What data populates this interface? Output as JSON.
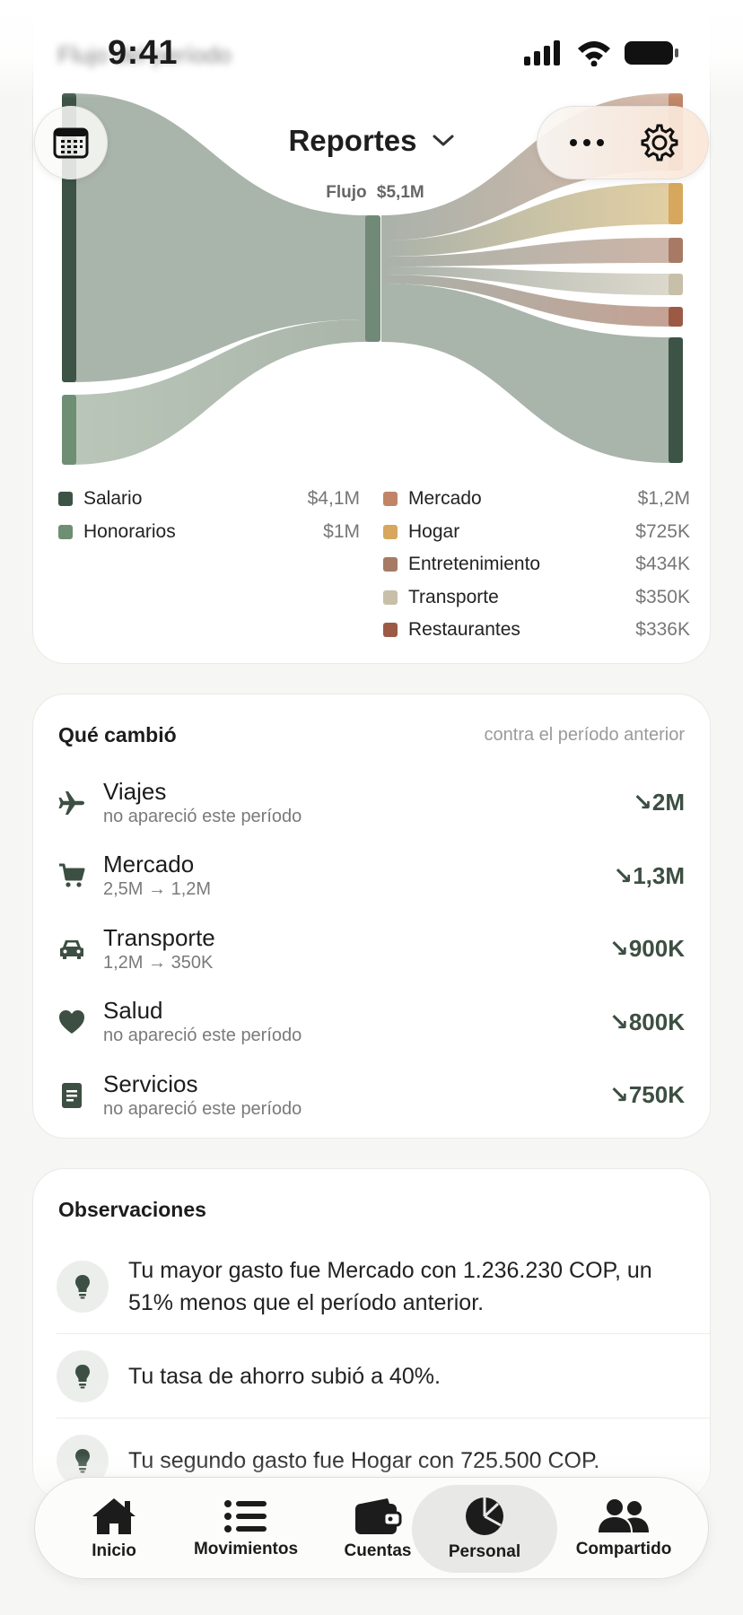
{
  "status": {
    "time": "9:41",
    "blurred_title": "Flujo del período"
  },
  "header": {
    "title": "Reportes"
  },
  "sankey": {
    "center_label": "Flujo",
    "center_value": "$5,1M",
    "income": [
      {
        "name": "Salario",
        "value": "$4,1M",
        "color": "#3d5346"
      },
      {
        "name": "Honorarios",
        "value": "$1M",
        "color": "#6e8f73"
      }
    ],
    "expenses": [
      {
        "name": "Mercado",
        "value": "$1,2M",
        "color": "#c08566"
      },
      {
        "name": "Hogar",
        "value": "$725K",
        "color": "#d6a75d"
      },
      {
        "name": "Entretenimiento",
        "value": "$434K",
        "color": "#a67a64"
      },
      {
        "name": "Transporte",
        "value": "$350K",
        "color": "#c8bfa8"
      },
      {
        "name": "Restaurantes",
        "value": "$336K",
        "color": "#9c5a44"
      }
    ]
  },
  "changes": {
    "title": "Qué cambió",
    "subtitle": "contra el período anterior",
    "items": [
      {
        "name": "Viajes",
        "detail": "no apareció este período",
        "value": "↘2M",
        "icon": "plane-icon"
      },
      {
        "name": "Mercado",
        "detail": "2,5M → 1,2M",
        "value": "↘1,3M",
        "icon": "cart-icon"
      },
      {
        "name": "Transporte",
        "detail": "1,2M → 350K",
        "value": "↘900K",
        "icon": "car-icon"
      },
      {
        "name": "Salud",
        "detail": "no apareció este período",
        "value": "↘800K",
        "icon": "heart-icon"
      },
      {
        "name": "Servicios",
        "detail": "no apareció este período",
        "value": "↘750K",
        "icon": "receipt-icon"
      }
    ]
  },
  "observations": {
    "title": "Observaciones",
    "items": [
      {
        "text": "Tu mayor gasto fue Mercado con 1.236.230 COP, un 51% menos que el período anterior."
      },
      {
        "text": "Tu tasa de ahorro subió a 40%."
      },
      {
        "text": "Tu segundo gasto fue Hogar con 725.500 COP."
      }
    ]
  },
  "tabs": [
    {
      "label": "Inicio",
      "icon": "home-icon"
    },
    {
      "label": "Movimientos",
      "icon": "list-icon"
    },
    {
      "label": "Cuentas",
      "icon": "wallet-icon"
    },
    {
      "label": "Personal",
      "icon": "pie-chart-icon",
      "active": true
    },
    {
      "label": "Compartido",
      "icon": "people-icon"
    }
  ]
}
